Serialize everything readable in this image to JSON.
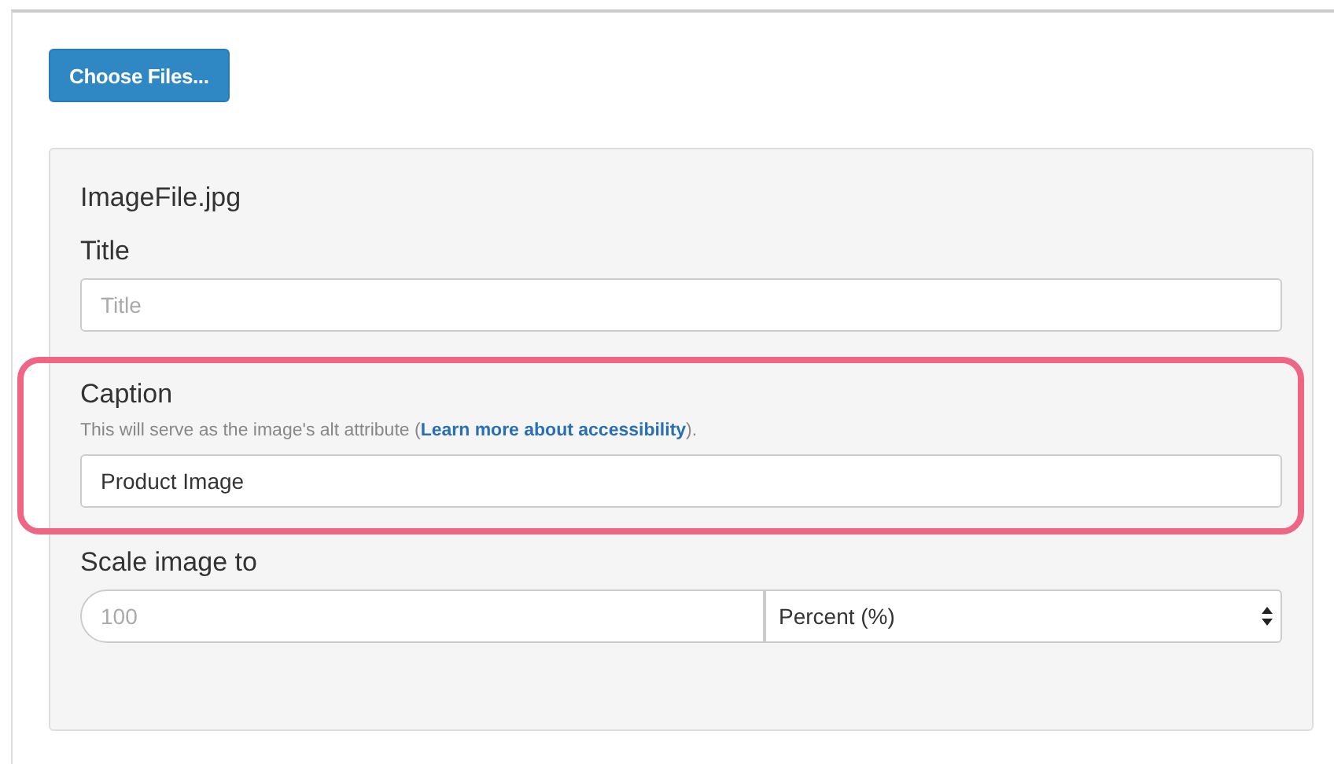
{
  "upload_button": "Choose Files...",
  "file_name": "ImageFile.jpg",
  "fields": [
    {
      "kind": "text",
      "label": "Title",
      "placeholder": "Title",
      "highlighted": false
    },
    {
      "kind": "caption",
      "label": "Caption",
      "help_before": "This will serve as the image's alt attribute (",
      "help_link": "Learn more about accessibility",
      "help_after": ").",
      "value": "Product Image",
      "highlighted": true
    },
    {
      "kind": "scale",
      "label": "Scale image to",
      "placeholder": "100",
      "unit": "Percent (%)",
      "highlighted": false
    }
  ]
}
